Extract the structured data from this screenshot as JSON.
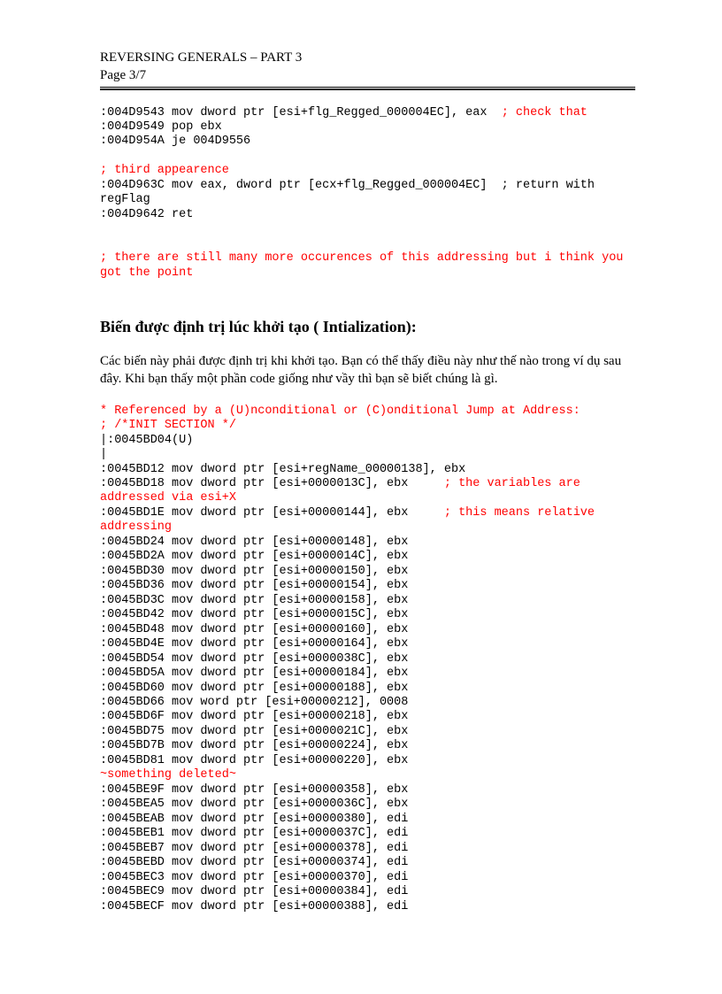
{
  "header": {
    "title": "REVERSING GENERALS – PART 3",
    "page": "Page 3/7"
  },
  "code1": {
    "l1a": ":004D9543 mov dword ptr [esi+flg_Regged_000004EC], eax  ",
    "l1b": "; check that",
    "l2": ":004D9549 pop ebx",
    "l3": ":004D954A je 004D9556",
    "l4": "; third appearence",
    "l5": ":004D963C mov eax, dword ptr [ecx+flg_Regged_000004EC]  ; return with regFlag",
    "l6": ":004D9642 ret",
    "l7": "; there are still many more occurences of this addressing but i think you got the point"
  },
  "section_title": "Biến được định trị lúc khởi tạo ( Intialization):",
  "body_text": "Các biến này phải được định trị khi khởi tạo. Bạn có thể thấy điều này như thế nào trong ví dụ sau đây. Khi bạn thấy một phần code giống như vầy thì bạn sẽ biết chúng là gì.",
  "code2": {
    "r1": "* Referenced by a (U)nconditional or (C)onditional Jump at Address:",
    "r2": "; /*INIT SECTION */",
    "b1": "|:0045BD04(U)",
    "b2": "|",
    "b3": ":0045BD12 mov dword ptr [esi+regName_00000138], ebx",
    "b4a": ":0045BD18 mov dword ptr [esi+0000013C], ebx     ",
    "b4b": "; the variables are addressed via esi+X",
    "b5a": ":0045BD1E mov dword ptr [esi+00000144], ebx     ",
    "b5b": "; this means relative addressing",
    "b6": ":0045BD24 mov dword ptr [esi+00000148], ebx",
    "b7": ":0045BD2A mov dword ptr [esi+0000014C], ebx",
    "b8": ":0045BD30 mov dword ptr [esi+00000150], ebx",
    "b9": ":0045BD36 mov dword ptr [esi+00000154], ebx",
    "b10": ":0045BD3C mov dword ptr [esi+00000158], ebx",
    "b11": ":0045BD42 mov dword ptr [esi+0000015C], ebx",
    "b12": ":0045BD48 mov dword ptr [esi+00000160], ebx",
    "b13": ":0045BD4E mov dword ptr [esi+00000164], ebx",
    "b14": ":0045BD54 mov dword ptr [esi+0000038C], ebx",
    "b15": ":0045BD5A mov dword ptr [esi+00000184], ebx",
    "b16": ":0045BD60 mov dword ptr [esi+00000188], ebx",
    "b17": ":0045BD66 mov word ptr [esi+00000212], 0008",
    "b18": ":0045BD6F mov dword ptr [esi+00000218], ebx",
    "b19": ":0045BD75 mov dword ptr [esi+0000021C], ebx",
    "b20": ":0045BD7B mov dword ptr [esi+00000224], ebx",
    "b21": ":0045BD81 mov dword ptr [esi+00000220], ebx",
    "r3": "~something deleted~",
    "b22": ":0045BE9F mov dword ptr [esi+00000358], ebx",
    "b23": ":0045BEA5 mov dword ptr [esi+0000036C], ebx",
    "b24": ":0045BEAB mov dword ptr [esi+00000380], edi",
    "b25": ":0045BEB1 mov dword ptr [esi+0000037C], edi",
    "b26": ":0045BEB7 mov dword ptr [esi+00000378], edi",
    "b27": ":0045BEBD mov dword ptr [esi+00000374], edi",
    "b28": ":0045BEC3 mov dword ptr [esi+00000370], edi",
    "b29": ":0045BEC9 mov dword ptr [esi+00000384], edi",
    "b30": ":0045BECF mov dword ptr [esi+00000388], edi"
  }
}
